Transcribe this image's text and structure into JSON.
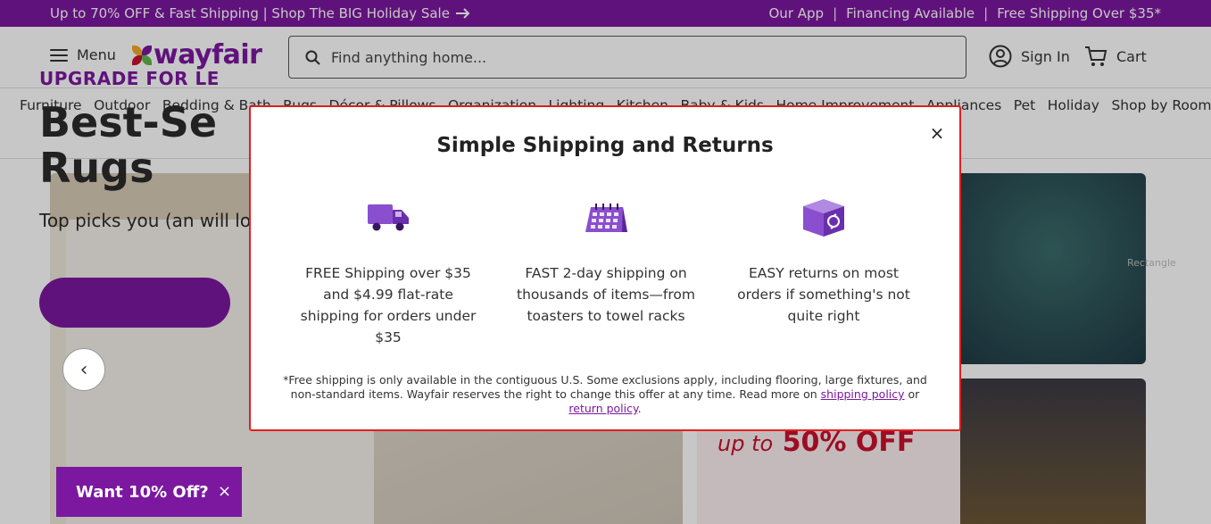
{
  "promo": {
    "left_text": "Up to 70% OFF & Fast Shipping | Shop The BIG Holiday Sale",
    "right_links": [
      "Our App",
      "Financing Available",
      "Free Shipping Over $35*"
    ],
    "separator": "|"
  },
  "header": {
    "menu_label": "Menu",
    "logo_text": "wayfair",
    "search_placeholder": "Find anything home...",
    "signin_label": "Sign In",
    "cart_label": "Cart"
  },
  "categories": [
    "Furniture",
    "Outdoor",
    "Bedding & Bath",
    "Rugs",
    "Décor & Pillows",
    "Organization",
    "Lighting",
    "Kitchen",
    "Baby & Kids",
    "Home Improvement",
    "Appliances",
    "Pet",
    "Holiday",
    "Shop by Room"
  ],
  "hero": {
    "kicker": "UPGRADE FOR LE",
    "title": "Best-Se Rugs",
    "subtitle": "Top picks you (an will love.",
    "sale_prefix": "up to",
    "sale_value": "50% OFF",
    "rect_label": "Rectangle"
  },
  "modal": {
    "title": "Simple Shipping and Returns",
    "close": "×",
    "features": [
      {
        "icon": "truck-icon",
        "text": "FREE Shipping over $35 and $4.99 flat-rate shipping for orders under $35"
      },
      {
        "icon": "calendar-icon",
        "text": "FAST 2-day shipping on thousands of items—from toasters to towel racks"
      },
      {
        "icon": "box-return-icon",
        "text": "EASY returns on most orders if something's not quite right"
      }
    ],
    "disclaimer_text": "*Free shipping is only available in the contiguous U.S. Some exclusions apply, including flooring, large fixtures, and non-standard items. Wayfair reserves the right to change this offer at any time. Read more on",
    "shipping_link": "shipping policy",
    "or_text": "or",
    "return_link": "return policy",
    "period": "."
  },
  "offer": {
    "label": "Want 10% Off?",
    "close": "×"
  },
  "colors": {
    "brand": "#7b189f",
    "sale_red": "#c8102e",
    "modal_border": "#e02020"
  }
}
